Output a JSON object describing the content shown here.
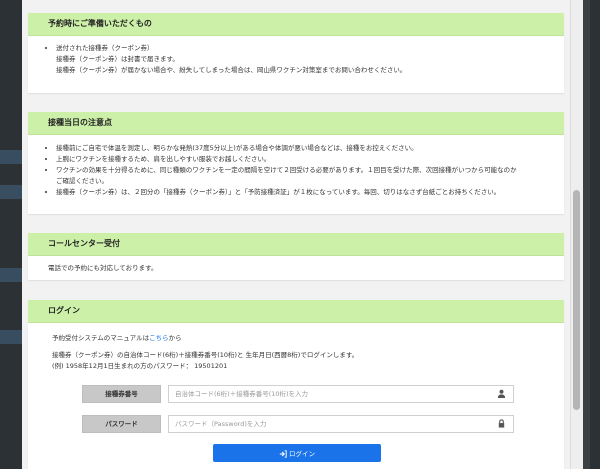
{
  "sections": {
    "prep": {
      "title": "予約時にご準備いただくもの",
      "lines": [
        "送付された接種券（クーポン券）",
        "接種券（クーポン券）は封書で届きます。",
        "接種券（クーポン券）が届かない場合や、紛失してしまった場合は、岡山県ワクチン対策室までお問い合わせください。"
      ]
    },
    "day": {
      "title": "接種当日の注意点",
      "items": [
        "接種前にご自宅で体温を測定し、明らかな発熱(37度5分以上)がある場合や体調が悪い場合などは、接種をお控えください。",
        "上腕にワクチンを接種するため、肩を出しやすい服装でお越しください。",
        "ワクチンの効果を十分得るために、同じ種類のワクチンを一定の間隔を空けて２回受ける必要があります。１回目を受けた際、次回接種がいつから可能なのか",
        "ご確認ください。",
        "接種券（クーポン券）は、２回分の「接種券（クーポン券）」と「予防接種済証」が１枚になっています。毎回、切りはなさず台紙ごとお持ちください。"
      ]
    },
    "call": {
      "title": "コールセンター受付",
      "text": "電話での予約にも対応しております。"
    },
    "login": {
      "title": "ログイン",
      "manual_prefix": "予約受付システムのマニュアルは",
      "manual_link": "こちら",
      "manual_suffix": "から",
      "instruction": "接種券（クーポン券）の自治体コード(6桁)＋接種券番号(10桁)と 生年月日(西暦8桁)でログインします。",
      "example": "(例) 1958年12月1日生まれの方のパスワード： 19501201",
      "coupon_label": "接種券番号",
      "coupon_placeholder": "自治体コード(6桁)＋接種券番号(10桁)を入力",
      "password_label": "パスワード",
      "password_placeholder": "パスワード（Password)を入力",
      "submit_label": "ログイン"
    }
  }
}
